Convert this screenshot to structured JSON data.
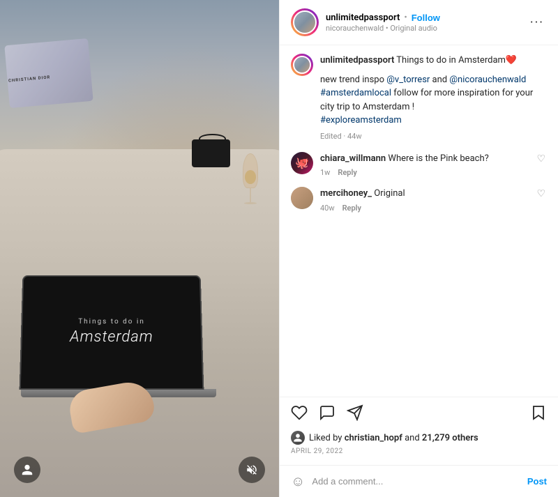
{
  "header": {
    "username": "unlimitedpassport",
    "dot": "•",
    "follow": "Follow",
    "subtext": "nicorauchenwald • Original audio",
    "more_icon": "···"
  },
  "caption": {
    "username": "unlimitedpassport",
    "text": " Things to do in Amsterdam",
    "heart": "❤️",
    "body": "new trend inspo ",
    "mention1": "@v_torresr",
    "and": " and ",
    "mention2": "@nicorauchenwald",
    "newline1": " ",
    "hashtag1": "#amsterdamlocal",
    "follow_text": " follow for more inspiration for your city trip to Amsterdam !",
    "newline2": " ",
    "hashtag2": "#exploreamsterdam",
    "edited": "Edited · 44w"
  },
  "comments": [
    {
      "username": "chiara_willmann",
      "text": " Where is the Pink beach?",
      "meta1": "1w",
      "meta2": "Reply",
      "avatar_type": "chiara"
    },
    {
      "username": "mercihoney_",
      "text": " Original",
      "meta1": "40w",
      "meta2": "Reply",
      "avatar_type": "merci"
    }
  ],
  "actions": {
    "like_icon": "♡",
    "comment_icon": "○",
    "share_icon": "▷",
    "save_icon": "⊡",
    "liked_by": "Liked by",
    "liker_name": "christian_hopf",
    "and": "and",
    "others_count": "21,279 others",
    "date": "APRIL 29, 2022"
  },
  "add_comment": {
    "emoji": "☺",
    "placeholder": "Add a comment...",
    "post_label": "Post"
  },
  "laptop_screen": {
    "small_text": "Things to do in",
    "large_text": "Amsterdam"
  },
  "colors": {
    "follow_blue": "#0095f6",
    "heart_red": "#e0302a"
  }
}
